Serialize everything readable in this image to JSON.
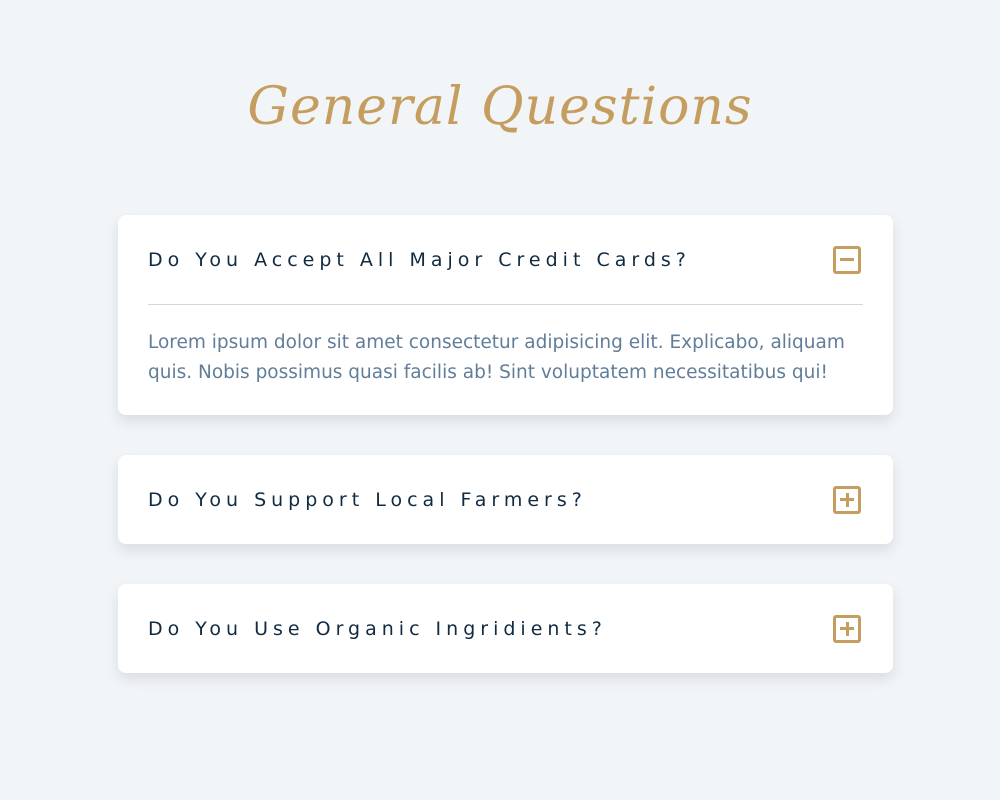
{
  "page": {
    "title": "General Questions"
  },
  "questions": [
    {
      "title": "Do You Accept All Major Credit Cards?",
      "answer": "Lorem ipsum dolor sit amet consectetur adipisicing elit. Explicabo, aliquam quis. Nobis possimus quasi facilis ab! Sint voluptatem necessitatibus qui!",
      "expanded": true,
      "icon": "minus-square-icon"
    },
    {
      "title": "Do You Support Local Farmers?",
      "expanded": false,
      "icon": "plus-square-icon"
    },
    {
      "title": "Do You Use Organic Ingridients?",
      "expanded": false,
      "icon": "plus-square-icon"
    }
  ],
  "colors": {
    "background": "#f1f5f8",
    "accent": "#c59d5f",
    "heading": "#102a42",
    "body_text": "#617d98",
    "card": "#ffffff"
  }
}
